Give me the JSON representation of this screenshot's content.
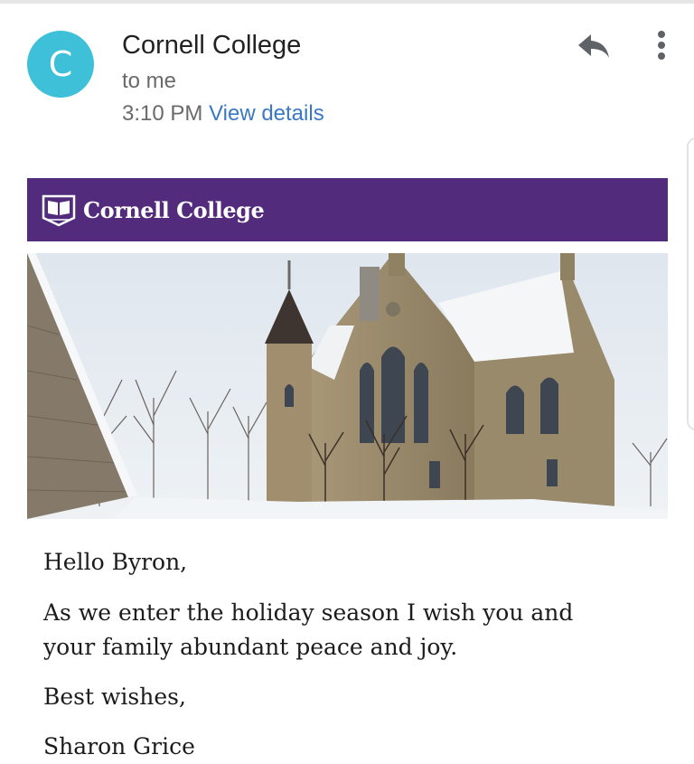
{
  "header": {
    "avatar_letter": "C",
    "avatar_color": "#3ec1d8",
    "sender": "Cornell College",
    "recipient": "to me",
    "time": "3:10 PM",
    "details_link": "View details",
    "reply_icon": "reply-icon",
    "more_icon": "more-vert-icon"
  },
  "email": {
    "banner_text": "Cornell College",
    "banner_color": "#532b7c",
    "greeting": "Hello Byron,",
    "body_line1": "As we enter the holiday season I wish you and",
    "body_line2": "your family abundant peace and joy.",
    "closing": "Best wishes,",
    "signature": "Sharon Grice"
  }
}
